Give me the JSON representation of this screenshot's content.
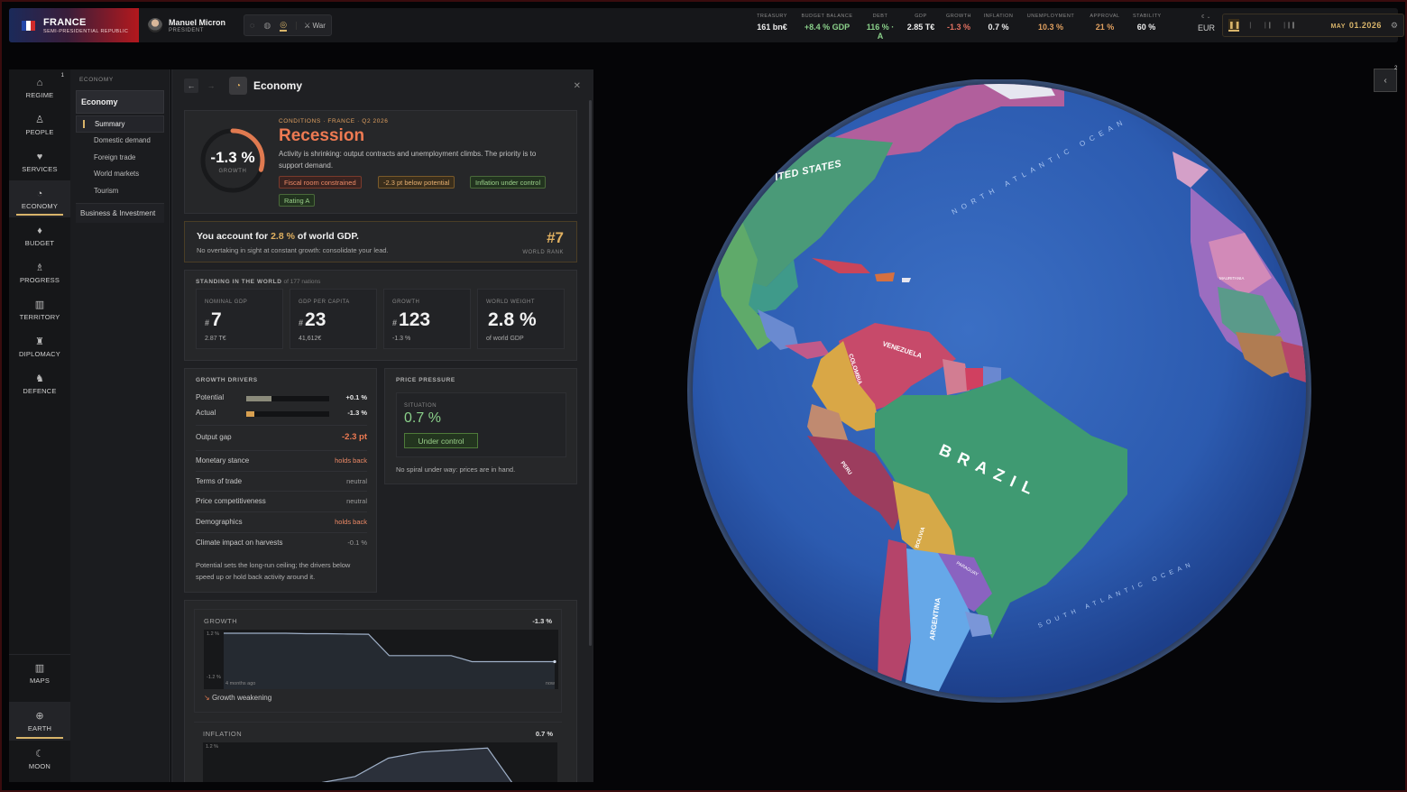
{
  "country": {
    "name": "FRANCE",
    "regime": "SEMI-PRESIDENTIAL REPUBLIC"
  },
  "leader": {
    "name": "Manuel Micron",
    "role": "PRESIDENT"
  },
  "modes": {
    "war_label": "War"
  },
  "stats": [
    {
      "label": "TREASURY",
      "value": "161 bn€",
      "tone": "neutral"
    },
    {
      "label": "BUDGET BALANCE",
      "value": "+8.4 % GDP",
      "tone": "green"
    },
    {
      "label": "DEBT",
      "value": "116 % · A",
      "tone": "green"
    },
    {
      "label": "GDP",
      "value": "2.85 T€",
      "tone": "neutral"
    },
    {
      "label": "GROWTH",
      "value": "-1.3 %",
      "tone": "red"
    },
    {
      "label": "INFLATION",
      "value": "0.7 %",
      "tone": "neutral"
    },
    {
      "label": "UNEMPLOYMENT",
      "value": "10.3 %",
      "tone": "orange"
    },
    {
      "label": "APPROVAL",
      "value": "21 %",
      "tone": "orange"
    },
    {
      "label": "STABILITY",
      "value": "60 %",
      "tone": "neutral"
    }
  ],
  "currency": {
    "symbol": "€",
    "code": "EUR"
  },
  "clock": {
    "month": "MAY",
    "day_year": "01.2026"
  },
  "rail": {
    "top": [
      {
        "key": "regime",
        "label": "REGIME",
        "icon": "⌂",
        "badge": "1"
      },
      {
        "key": "people",
        "label": "PEOPLE",
        "icon": "♙"
      },
      {
        "key": "services",
        "label": "SERVICES",
        "icon": "♥"
      },
      {
        "key": "economy",
        "label": "ECONOMY",
        "icon": "◔",
        "active": true
      },
      {
        "key": "budget",
        "label": "BUDGET",
        "icon": "♦"
      },
      {
        "key": "progress",
        "label": "PROGRESS",
        "icon": "♗"
      },
      {
        "key": "territory",
        "label": "TERRITORY",
        "icon": "▥"
      },
      {
        "key": "diplomacy",
        "label": "DIPLOMACY",
        "icon": "♜"
      },
      {
        "key": "defence",
        "label": "DEFENCE",
        "icon": "♞"
      }
    ],
    "maps": {
      "label": "MAPS",
      "icon": "▥"
    },
    "earth": {
      "label": "EARTH",
      "icon": "⊕"
    },
    "moon": {
      "label": "MOON",
      "icon": "☾"
    }
  },
  "subnav": {
    "heading": "ECONOMY",
    "selected": "Economy",
    "items": [
      "Summary",
      "Domestic demand",
      "Foreign trade",
      "World markets",
      "Tourism"
    ],
    "group": "Business & Investment"
  },
  "panel": {
    "title": "Economy",
    "conditions": {
      "tag": "CONDITIONS · FRANCE · Q2 2026",
      "title": "Recession",
      "description": "Activity is shrinking: output contracts and unemployment climbs. The priority is to support demand.",
      "growth_value": "-1.3 %",
      "growth_label": "GROWTH",
      "gauge_fraction": 0.3,
      "pills": [
        {
          "label": "Fiscal room constrained",
          "tone": "red"
        },
        {
          "label": "-2.3 pt below potential",
          "tone": "orange"
        },
        {
          "label": "Inflation under control",
          "tone": "green"
        },
        {
          "label": "Rating A",
          "tone": "green"
        }
      ]
    },
    "share": {
      "lead": "You account for ",
      "value": "2.8 %",
      "tail": " of world GDP.",
      "subtitle": "No overtaking in sight at constant growth: consolidate your lead.",
      "rank": "#7",
      "rank_label": "WORLD RANK"
    },
    "standing": {
      "heading": "STANDING IN THE WORLD",
      "of": "of 177 nations",
      "cards": [
        {
          "label": "NOMINAL GDP",
          "hash": "#",
          "value": "7",
          "sub": "2.87 T€"
        },
        {
          "label": "GDP PER CAPITA",
          "hash": "#",
          "value": "23",
          "sub": "41,612€"
        },
        {
          "label": "GROWTH",
          "hash": "#",
          "value": "123",
          "sub": "-1.3 %"
        },
        {
          "label": "WORLD WEIGHT",
          "hash": "",
          "value": "2.8 %",
          "sub": "of world GDP"
        }
      ]
    },
    "drivers": {
      "heading": "GROWTH DRIVERS",
      "potential": {
        "label": "Potential",
        "value": "+0.1 %",
        "fill": 0.3
      },
      "actual": {
        "label": "Actual",
        "value": "-1.3 %",
        "fill": 0.1
      },
      "output_gap": {
        "label": "Output gap",
        "value": "-2.3 pt"
      },
      "rows": [
        {
          "label": "Monetary stance",
          "value": "holds back",
          "tone": "red"
        },
        {
          "label": "Terms of trade",
          "value": "neutral",
          "tone": "neutral"
        },
        {
          "label": "Price competitiveness",
          "value": "neutral",
          "tone": "neutral"
        },
        {
          "label": "Demographics",
          "value": "holds back",
          "tone": "red"
        },
        {
          "label": "Climate impact on harvests",
          "value": "-0.1 %",
          "tone": "neutral"
        }
      ],
      "note": "Potential sets the long-run ceiling; the drivers below speed up or hold back activity around it."
    },
    "price": {
      "heading": "PRICE PRESSURE",
      "situation_label": "SITUATION",
      "value": "0.7 %",
      "status": "Under control",
      "note": "No spiral under way: prices are in hand."
    },
    "growth_chart": {
      "label": "GROWTH",
      "value": "-1.3 %",
      "y_top": "1.2 %",
      "y_bottom": "-1.2 %",
      "x_start": "4 months ago",
      "x_end": "now",
      "trend": "Growth weakening"
    },
    "inflation_chart": {
      "label": "INFLATION",
      "value": "0.7 %",
      "y_top": "1.2 %"
    }
  },
  "globe": {
    "labels": {
      "usa": "ITED STATES",
      "n_atlantic": "NORTH ATLANTIC OCEAN",
      "s_atlantic": "SOUTH ATLANTIC OCEAN",
      "venezuela": "VENEZUELA",
      "colombia": "COLOMBIA",
      "brazil": "BRAZIL",
      "peru": "PERU",
      "bolivia": "BOLIVIA",
      "argentina": "ARGENTINA",
      "paraguay": "PARAGUAY",
      "mauritania": "MAURITANIA"
    }
  },
  "side_toggle": {
    "badge": "2"
  },
  "chart_data": [
    {
      "type": "line",
      "title": "GROWTH",
      "x": [
        0,
        1,
        2,
        3,
        4,
        5,
        6,
        7,
        8,
        9,
        10,
        11,
        12,
        13,
        14,
        15,
        16
      ],
      "xlabel_start": "4 months ago",
      "xlabel_end": "now",
      "values": [
        1.2,
        1.2,
        1.2,
        1.2,
        1.18,
        1.18,
        1.16,
        1.15,
        0.1,
        0.1,
        0.1,
        0.1,
        -0.2,
        -0.2,
        -0.2,
        -0.2,
        -0.2
      ],
      "ylim": [
        -1.2,
        1.2
      ]
    },
    {
      "type": "line",
      "title": "INFLATION",
      "x": [
        0,
        1,
        2,
        3,
        4,
        5,
        6,
        7,
        8,
        9,
        10
      ],
      "values": [
        0.0,
        0.1,
        0.2,
        0.3,
        0.45,
        0.9,
        1.05,
        1.1,
        1.15,
        0.0,
        0.0
      ],
      "ylim": [
        0,
        1.2
      ]
    }
  ]
}
